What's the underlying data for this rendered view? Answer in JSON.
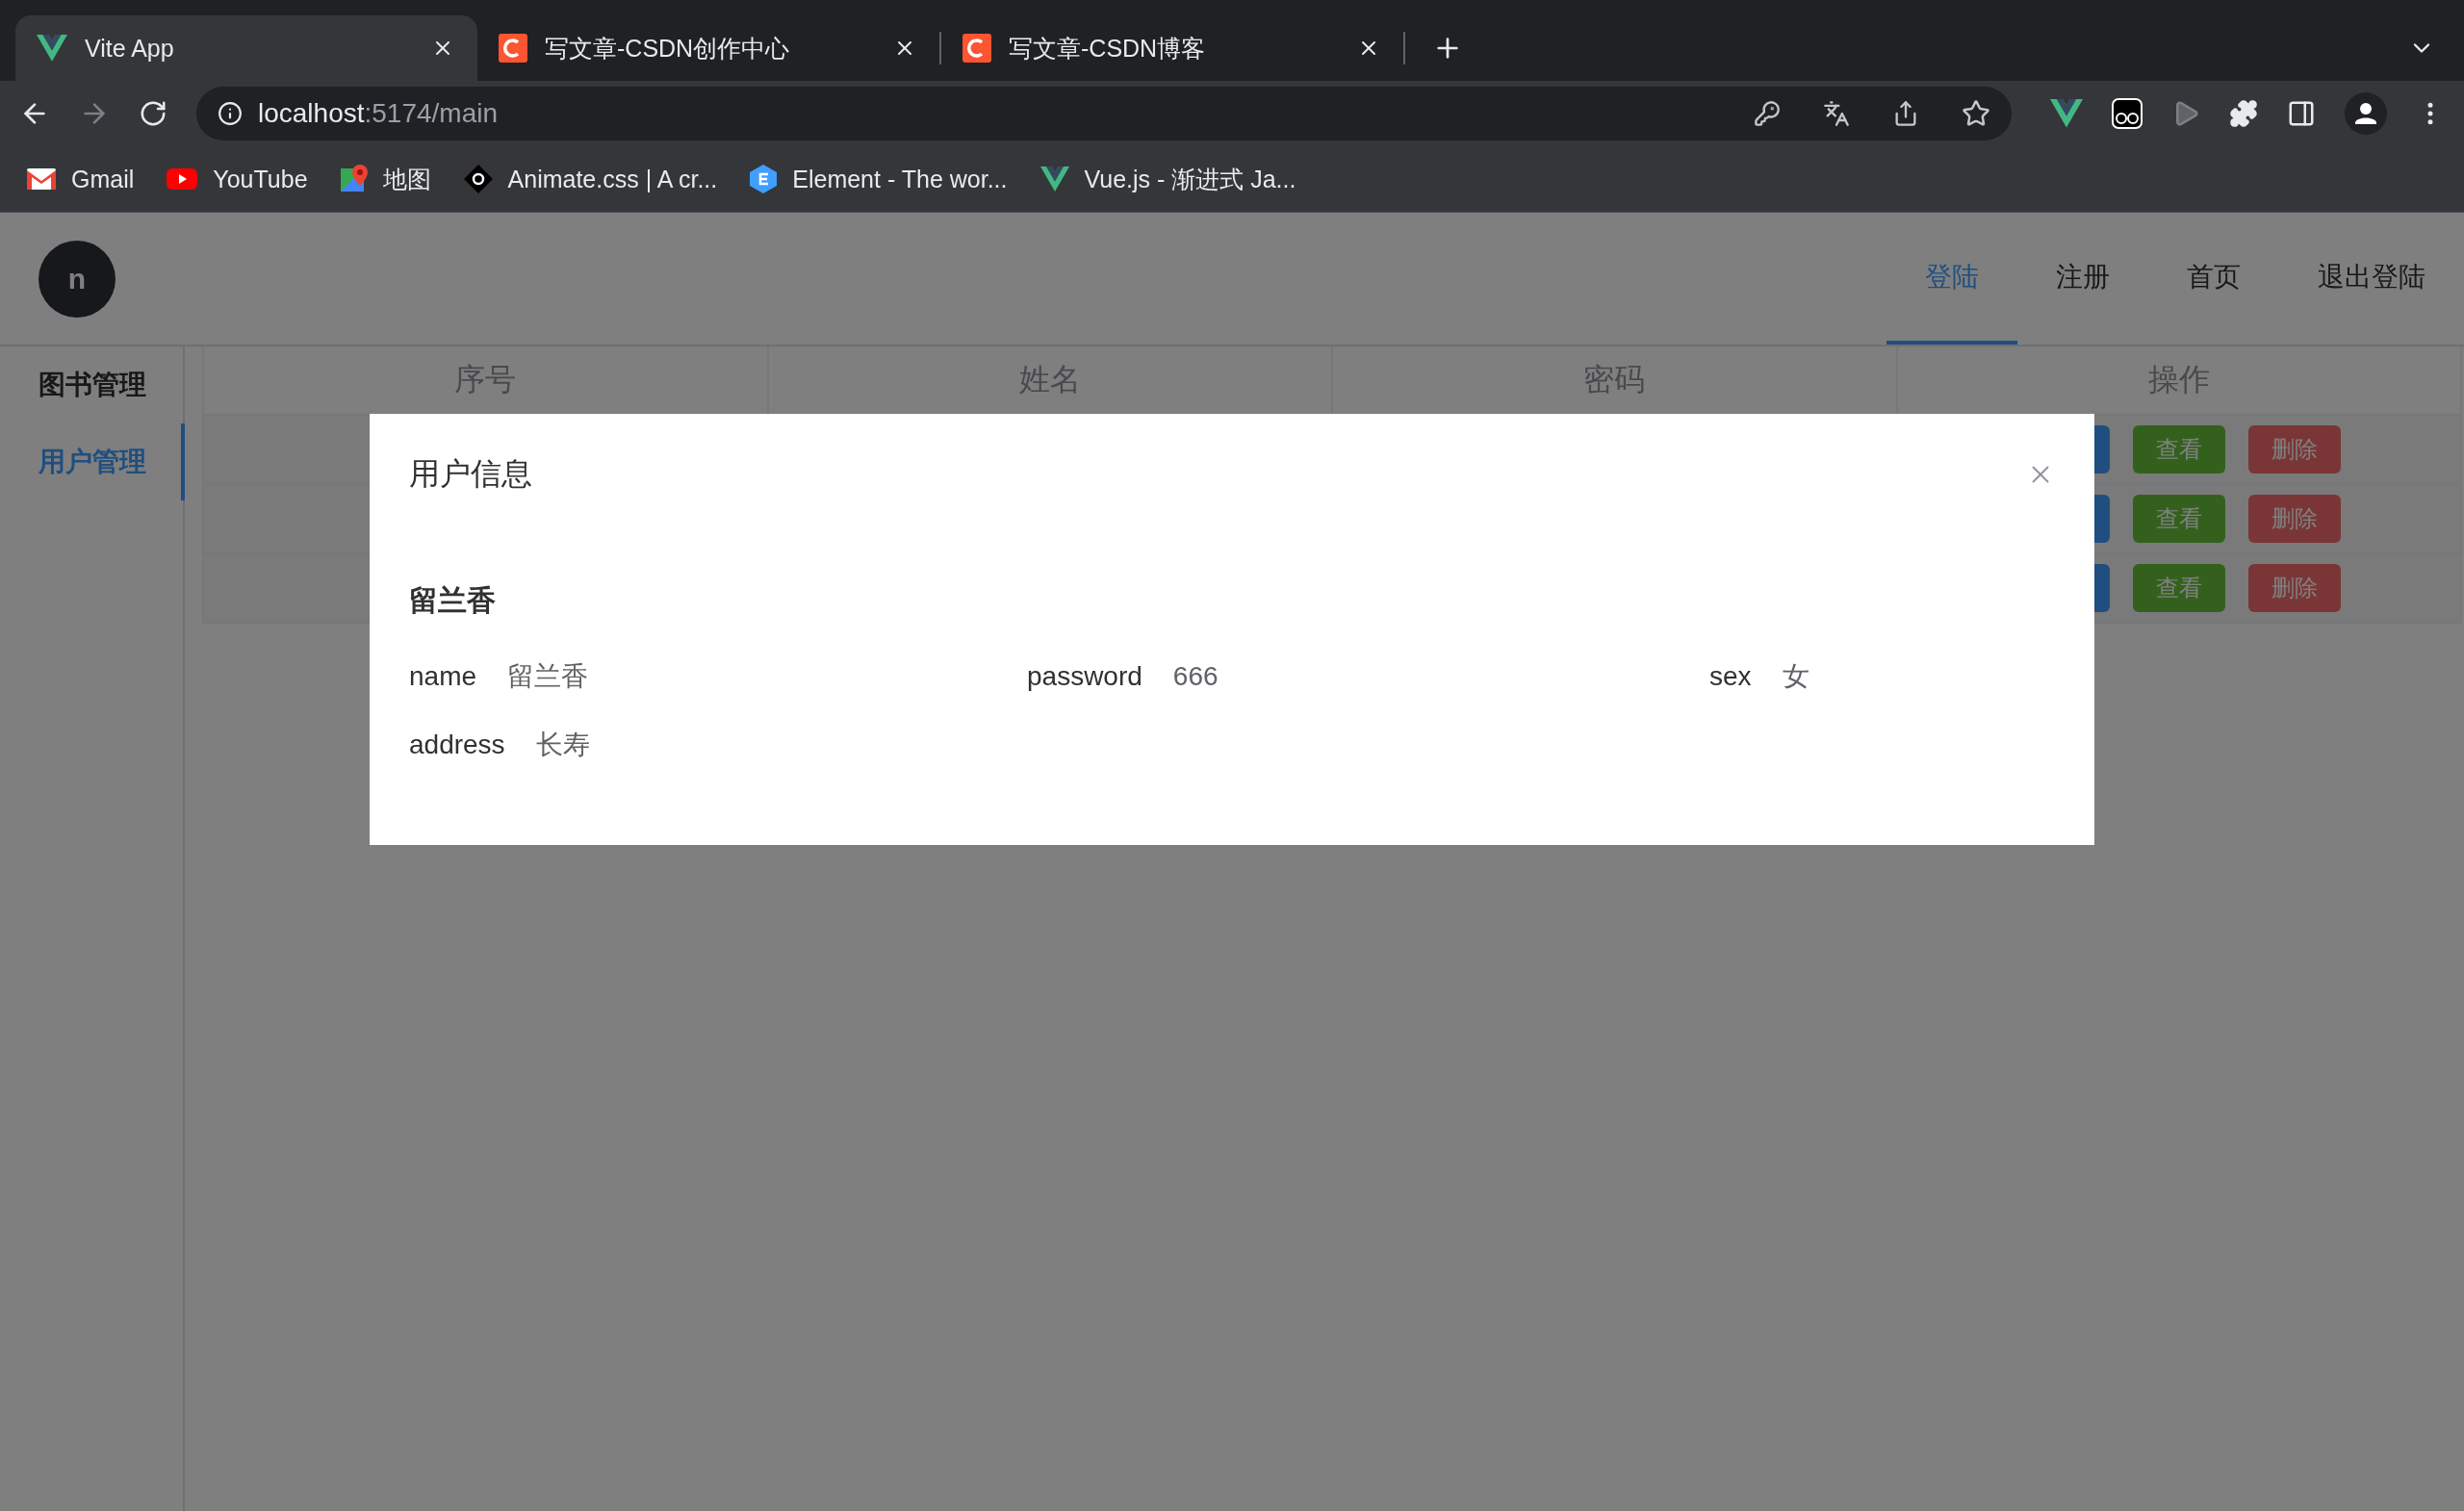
{
  "browser": {
    "tabs": [
      {
        "title": "Vite App",
        "kind": "vue",
        "selected": true
      },
      {
        "title": "写文章-CSDN创作中心",
        "kind": "csdn",
        "selected": false
      },
      {
        "title": "写文章-CSDN博客",
        "kind": "csdn",
        "selected": false
      }
    ],
    "address": {
      "host": "localhost",
      "rest": ":5174/main"
    },
    "bookmarks": [
      {
        "label": "Gmail",
        "kind": "gmail"
      },
      {
        "label": "YouTube",
        "kind": "youtube"
      },
      {
        "label": "地图",
        "kind": "maps"
      },
      {
        "label": "Animate.css | A cr...",
        "kind": "animate"
      },
      {
        "label": "Element - The wor...",
        "kind": "element"
      },
      {
        "label": "Vue.js - 渐进式 Ja...",
        "kind": "vue"
      }
    ]
  },
  "header": {
    "avatar": "n",
    "nav": [
      {
        "label": "登陆",
        "selected": true
      },
      {
        "label": "注册",
        "selected": false
      },
      {
        "label": "首页",
        "selected": false
      },
      {
        "label": "退出登陆",
        "selected": false
      }
    ]
  },
  "sidebar": {
    "items": [
      {
        "label": "图书管理",
        "selected": false
      },
      {
        "label": "用户管理",
        "selected": true
      }
    ]
  },
  "table": {
    "columns": [
      "序号",
      "姓名",
      "密码",
      "操作"
    ],
    "rows": [
      {
        "actions": [
          {
            "kind": "primary"
          },
          {
            "kind": "success",
            "label": "查看"
          },
          {
            "kind": "danger",
            "label": "删除"
          }
        ]
      },
      {
        "actions": [
          {
            "kind": "primary"
          },
          {
            "kind": "success",
            "label": "查看"
          },
          {
            "kind": "danger",
            "label": "删除"
          }
        ]
      },
      {
        "actions": [
          {
            "kind": "primary"
          },
          {
            "kind": "success",
            "label": "查看"
          },
          {
            "kind": "danger",
            "label": "删除"
          }
        ]
      }
    ]
  },
  "dialog": {
    "title": "用户信息",
    "heading": "留兰香",
    "fields": [
      {
        "label": "name",
        "value": "留兰香"
      },
      {
        "label": "password",
        "value": "666"
      },
      {
        "label": "sex",
        "value": "女"
      },
      {
        "label": "address",
        "value": "长寿"
      }
    ]
  }
}
